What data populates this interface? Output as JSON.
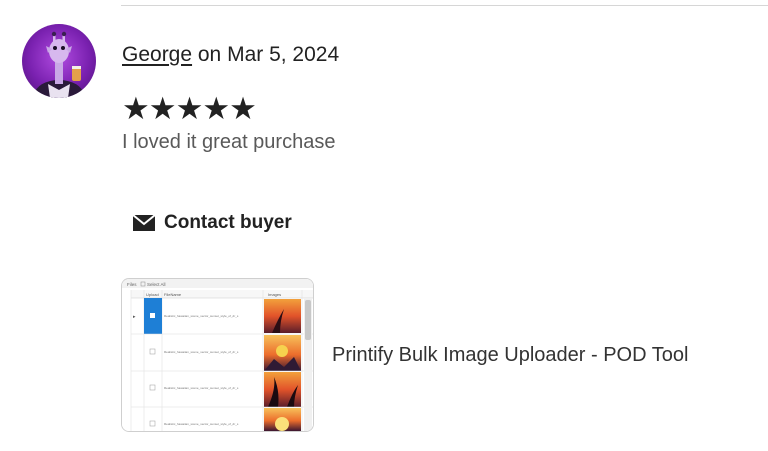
{
  "review": {
    "reviewer_name": "George",
    "date_text": " on Mar 5, 2024",
    "rating": 5,
    "stars": "★★★★★",
    "text": "I loved it great purchase"
  },
  "actions": {
    "contact_label": "Contact buyer",
    "contact_icon": "envelope-icon"
  },
  "product": {
    "title": "Printify Bulk Image Uploader - POD Tool",
    "thumbnail_header": [
      "Files",
      "Select All"
    ],
    "thumbnail_columns": [
      "Upload",
      "FileName",
      "Images"
    ],
    "thumbnail_row_text": "Realistic_hawaiian_scene_vector_sunset_style_of_dr_s"
  },
  "colors": {
    "text": "#222222",
    "muted_text": "#595959",
    "avatar_purple": "#7a21b0",
    "thumb_selected_blue": "#1e7fd6"
  }
}
